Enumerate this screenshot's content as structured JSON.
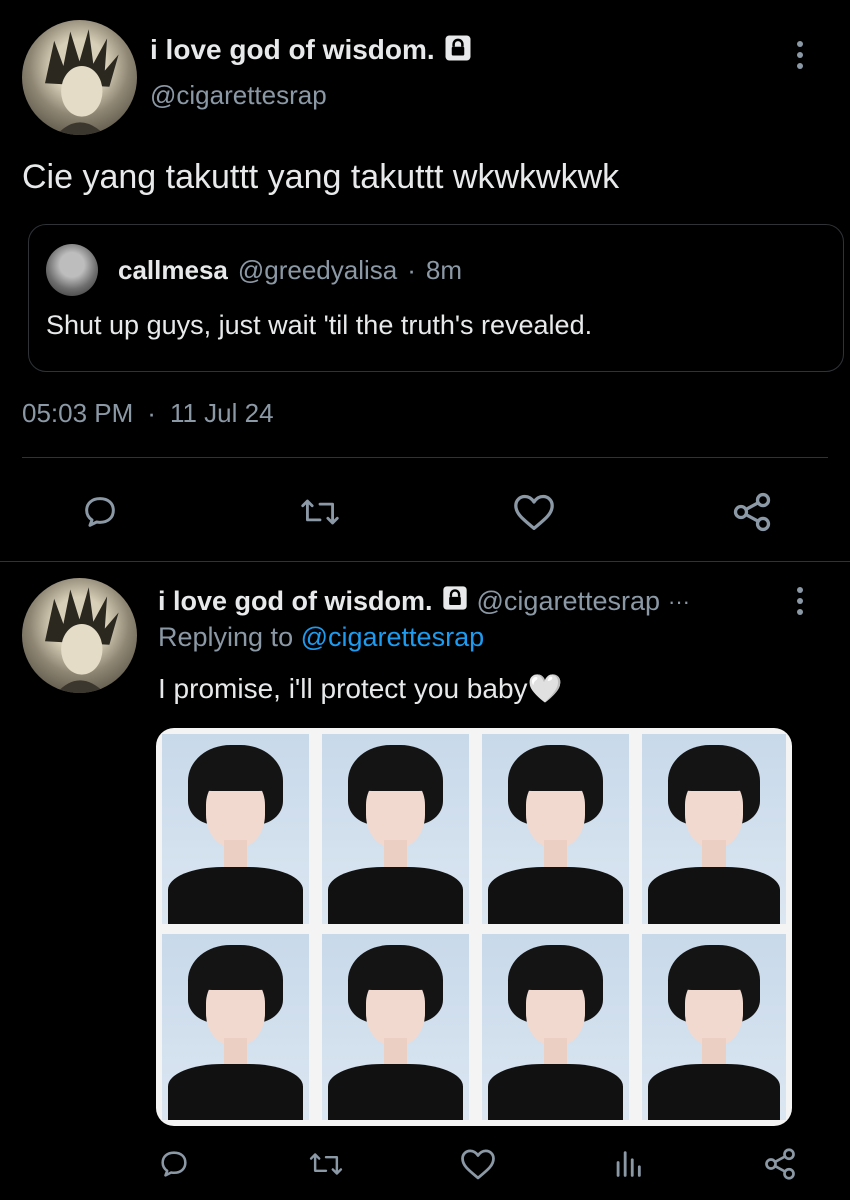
{
  "tweet1": {
    "display_name": "i love god of wisdom.",
    "handle": "@cigarettesrap",
    "text": "Cie yang takuttt yang takuttt wkwkwkwk",
    "quote": {
      "display_name": "callmesa",
      "handle": "@greedyalisa",
      "separator": "·",
      "time": "8m",
      "text": "Shut up guys, just wait 'til the truth's revealed."
    },
    "time": "05:03 PM",
    "dot": "·",
    "date": "11 Jul 24"
  },
  "tweet2": {
    "display_name": "i love god of wisdom.",
    "handle": "@cigarettesrap",
    "ellipsis": "···",
    "replying_prefix": "Replying to",
    "replying_handle": "@cigarettesrap",
    "text": "I promise, i'll protect you baby🤍"
  },
  "icons": {
    "reply": "reply-icon",
    "retweet": "retweet-icon",
    "like": "heart-icon",
    "share": "share-icon",
    "views": "views-icon",
    "more": "more-vertical-icon",
    "lock": "lock-icon"
  },
  "colors": {
    "background": "#000000",
    "text": "#e7e9ea",
    "muted": "#8b98a5",
    "link": "#1d9bf0",
    "divider": "#2f3336"
  }
}
